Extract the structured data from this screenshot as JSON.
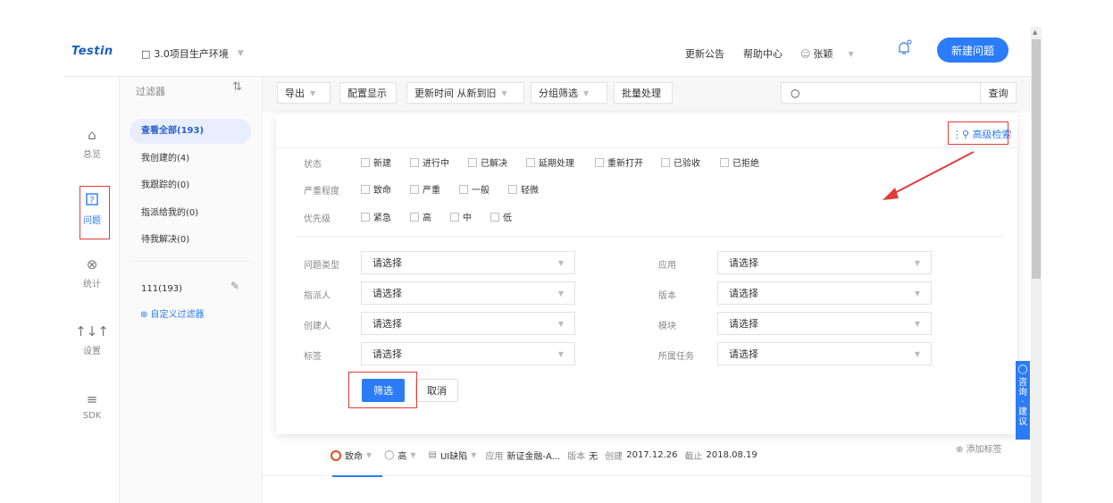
{
  "header": {
    "logo": "Testin",
    "project": "3.0项目生产环境",
    "links": [
      "更新公告",
      "帮助中心"
    ],
    "user": "张颖",
    "new_issue": "新建问题"
  },
  "leftnav": [
    {
      "label": "总览",
      "icon": "home-icon"
    },
    {
      "label": "问题",
      "icon": "issue-icon",
      "active": true
    },
    {
      "label": "统计",
      "icon": "stats-icon"
    },
    {
      "label": "设置",
      "icon": "settings-icon"
    },
    {
      "label": "SDK",
      "icon": "sdk-icon"
    }
  ],
  "filters": {
    "title": "过滤器",
    "items": [
      "查看全部(193)",
      "我创建的(4)",
      "我跟踪的(0)",
      "指派给我的(0)",
      "待我解决(0)"
    ],
    "custom_item": "111(193)",
    "custom_add": "⊕ 自定义过滤器"
  },
  "toolbar": {
    "export": "导出",
    "config": "配置显示",
    "sort": "更新时间 从新到旧",
    "group": "分组筛选",
    "batch": "批量处理",
    "search_placeholder": "",
    "search_btn": "查询"
  },
  "panel": {
    "advanced": "高级检索",
    "status_label": "状态",
    "status_options": [
      "新建",
      "进行中",
      "已解决",
      "延期处理",
      "重新打开",
      "已验收",
      "已拒绝"
    ],
    "severity_label": "严重程度",
    "severity_options": [
      "致命",
      "严重",
      "一般",
      "轻微"
    ],
    "priority_label": "优先级",
    "priority_options": [
      "紧急",
      "高",
      "中",
      "低"
    ],
    "selects": {
      "issue_type": "问题类型",
      "assignee": "指派人",
      "creator": "创建人",
      "tag": "标签",
      "app": "应用",
      "version": "版本",
      "module": "模块",
      "task": "所属任务",
      "placeholder": "请选择"
    },
    "filter_btn": "筛选",
    "cancel_btn": "取消"
  },
  "row": {
    "severity": "致命",
    "priority": "高",
    "type": "UI缺陷",
    "app_label": "应用",
    "app": "新证金融-A...",
    "version_label": "版本",
    "version": "无",
    "created_label": "创建",
    "created": "2017.12.26",
    "deadline_label": "截止",
    "deadline": "2018.08.19",
    "add_tag": "⊕ 添加标签"
  },
  "consult": [
    "咨",
    "询",
    "·",
    "建",
    "议"
  ]
}
